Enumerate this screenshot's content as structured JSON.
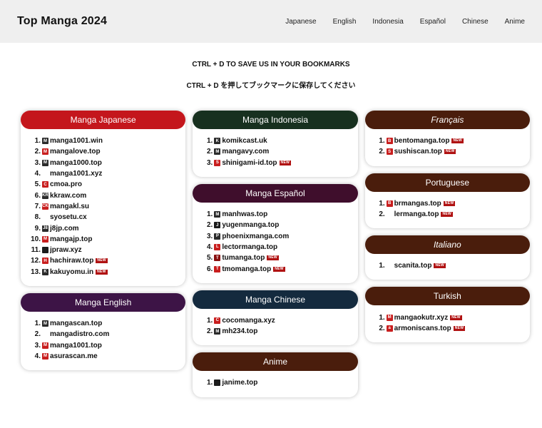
{
  "header": {
    "title": "Top Manga 2024",
    "nav": [
      "Japanese",
      "English",
      "Indonesia",
      "Español",
      "Chinese",
      "Anime"
    ]
  },
  "notice": {
    "en": "CTRL + D TO SAVE US IN YOUR BOOKMARKS",
    "jp": "CTRL + D を押してブックマークに保存してください"
  },
  "new_label": "NEW",
  "colors": {
    "japanese": "#c4161c",
    "english": "#3d1446",
    "indonesia": "#17301f",
    "espanol": "#3f0e2c",
    "chinese": "#142a3e",
    "anime": "#4a1d0c",
    "francais": "#4a1d0c",
    "portuguese": "#4a1d0c",
    "italiano": "#4a1d0c",
    "turkish": "#4a1d0c"
  },
  "columns": [
    [
      {
        "key": "japanese",
        "title": "Manga Japanese",
        "italic": false,
        "items": [
          {
            "n": "1.",
            "site": "manga1001.win",
            "icon": "m-dark-icon",
            "new": false
          },
          {
            "n": "2.",
            "site": "mangalove.top",
            "icon": "m-red-icon",
            "new": false
          },
          {
            "n": "3.",
            "site": "manga1000.top",
            "icon": "m-dark-icon",
            "new": false
          },
          {
            "n": "4.",
            "site": "manga1001.xyz",
            "icon": "blank",
            "new": false
          },
          {
            "n": "5.",
            "site": "cmoa.pro",
            "icon": "c-red-icon",
            "new": false
          },
          {
            "n": "6.",
            "site": "kkraw.com",
            "icon": "kr-dark-icon",
            "new": false
          },
          {
            "n": "7.",
            "site": "mangakl.su",
            "icon": "ck-red-icon",
            "new": false
          },
          {
            "n": "8.",
            "site": "syosetu.cx",
            "icon": "blank",
            "new": false
          },
          {
            "n": "9.",
            "site": "j8jp.com",
            "icon": "j8-dark-icon",
            "new": false
          },
          {
            "n": "10.",
            "site": "mangajp.top",
            "icon": "m-red-icon",
            "new": false
          },
          {
            "n": "11.",
            "site": "jpraw.xyz",
            "icon": "dot-dark-icon",
            "new": false
          },
          {
            "n": "12.",
            "site": "hachiraw.top",
            "icon": "h-red-icon",
            "new": true
          },
          {
            "n": "13.",
            "site": "kakuyomu.in",
            "icon": "k-dark-icon",
            "new": true
          }
        ]
      },
      {
        "key": "english",
        "title": "Manga English",
        "italic": false,
        "items": [
          {
            "n": "1.",
            "site": "mangascan.top",
            "icon": "m-dark-icon",
            "new": false
          },
          {
            "n": "2.",
            "site": "mangadistro.com",
            "icon": "blank",
            "new": false
          },
          {
            "n": "3.",
            "site": "manga1001.top",
            "icon": "m-red-icon",
            "new": false
          },
          {
            "n": "4.",
            "site": "asurascan.me",
            "icon": "m-red-icon",
            "new": false
          }
        ]
      }
    ],
    [
      {
        "key": "indonesia",
        "title": "Manga Indonesia",
        "italic": false,
        "items": [
          {
            "n": "1.",
            "site": "komikcast.uk",
            "icon": "k-dark-icon",
            "new": false
          },
          {
            "n": "2.",
            "site": "mangavy.com",
            "icon": "m-dark-icon",
            "new": false
          },
          {
            "n": "3.",
            "site": "shinigami-id.top",
            "icon": "s-red-icon",
            "new": true
          }
        ]
      },
      {
        "key": "espanol",
        "title": "Manga Español",
        "italic": false,
        "items": [
          {
            "n": "1.",
            "site": "manhwas.top",
            "icon": "m-dark-icon",
            "new": false
          },
          {
            "n": "2.",
            "site": "yugenmanga.top",
            "icon": "j-dark-icon",
            "new": false
          },
          {
            "n": "3.",
            "site": "phoenixmanga.com",
            "icon": "p-dark-icon",
            "new": false
          },
          {
            "n": "4.",
            "site": "lectormanga.top",
            "icon": "l-red-icon",
            "new": false
          },
          {
            "n": "5.",
            "site": "tumanga.top",
            "icon": "t-darkred-icon",
            "new": true
          },
          {
            "n": "6.",
            "site": "tmomanga.top",
            "icon": "t-red-icon",
            "new": true
          }
        ]
      },
      {
        "key": "chinese",
        "title": "Manga Chinese",
        "italic": false,
        "items": [
          {
            "n": "1.",
            "site": "cocomanga.xyz",
            "icon": "c-red-icon",
            "new": false
          },
          {
            "n": "2.",
            "site": "mh234.top",
            "icon": "m-dark-icon",
            "new": false
          }
        ]
      },
      {
        "key": "anime",
        "title": "Anime",
        "italic": false,
        "items": [
          {
            "n": "1.",
            "site": "janime.top",
            "icon": "dot-dark-icon",
            "new": false
          }
        ]
      }
    ],
    [
      {
        "key": "francais",
        "title": "Français",
        "italic": true,
        "items": [
          {
            "n": "1.",
            "site": "bentomanga.top",
            "icon": "b-red-icon",
            "new": true
          },
          {
            "n": "2.",
            "site": "sushiscan.top",
            "icon": "s-red-icon",
            "new": true
          }
        ]
      },
      {
        "key": "portuguese",
        "title": "Portuguese",
        "italic": false,
        "items": [
          {
            "n": "1.",
            "site": "brmangas.top",
            "icon": "b-red-icon",
            "new": true
          },
          {
            "n": "2.",
            "site": "lermanga.top",
            "icon": "blank",
            "new": true
          }
        ]
      },
      {
        "key": "italiano",
        "title": "Italiano",
        "italic": true,
        "items": [
          {
            "n": "1.",
            "site": "scanita.top",
            "icon": "blank",
            "new": true
          }
        ]
      },
      {
        "key": "turkish",
        "title": "Turkish",
        "italic": false,
        "items": [
          {
            "n": "1.",
            "site": "mangaokutr.xyz",
            "icon": "m-red-icon",
            "new": true
          },
          {
            "n": "2.",
            "site": "armoniscans.top",
            "icon": "a-red-icon",
            "new": true
          }
        ]
      }
    ]
  ]
}
